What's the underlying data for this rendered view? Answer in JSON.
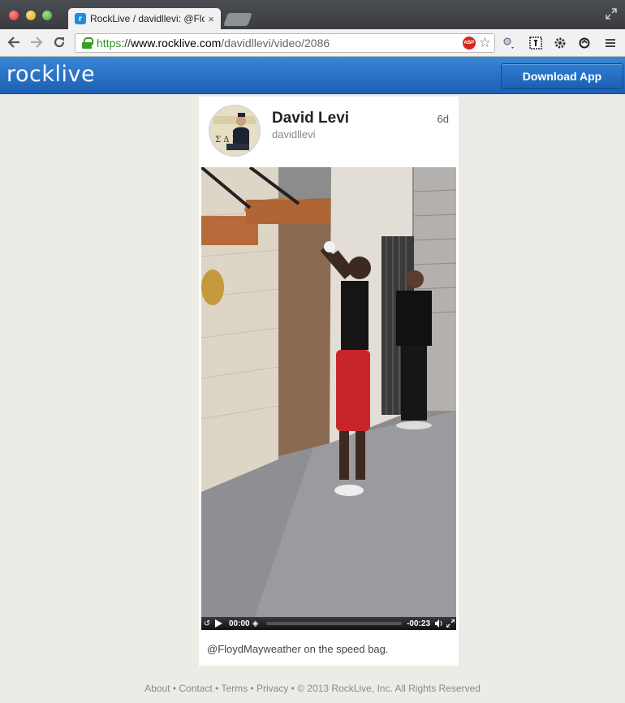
{
  "browser": {
    "tab": {
      "favicon": "r",
      "title": "RockLive / davidllevi: @Flo",
      "close": "×"
    },
    "url": {
      "scheme": "https",
      "sep": "://",
      "host": "www.rocklive.com",
      "path": "/davidllevi/video/2086"
    },
    "abp": "ABP"
  },
  "header": {
    "logo": "rocklive",
    "download_label": "Download App"
  },
  "post": {
    "name": "David Levi",
    "handle": "davidllevi",
    "age": "6d",
    "caption": "@FloydMayweather on the speed bag.",
    "video": {
      "current_time": "00:00",
      "remaining_time": "-00:23"
    }
  },
  "footer": {
    "about": "About",
    "contact": "Contact",
    "terms": "Terms",
    "privacy": "Privacy",
    "sep": "•",
    "copyright": "© 2013 RockLive, Inc. All Rights Reserved"
  },
  "colors": {
    "header_blue": "#2a72c8",
    "secure_green": "#2d9a2d",
    "page_bg": "#ecebe6"
  }
}
